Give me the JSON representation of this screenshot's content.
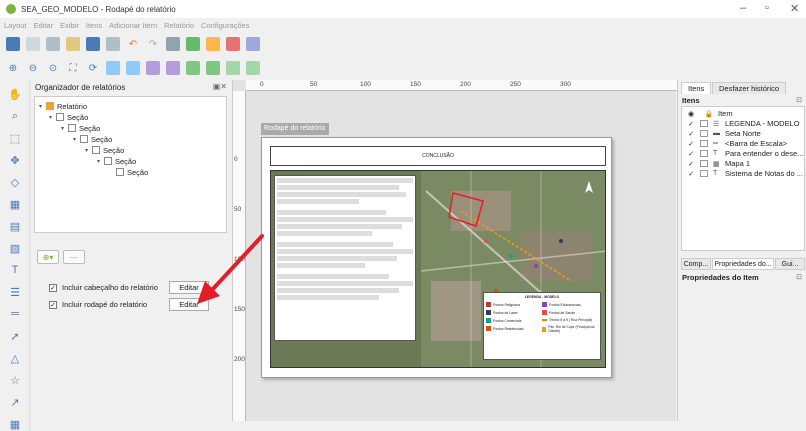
{
  "window": {
    "title": "SEA_GEO_MODELO - Rodapé do relatório"
  },
  "menu": [
    "Layout",
    "Editar",
    "Exibir",
    "Itens",
    "Adicionar Item",
    "Relatório",
    "Configurações"
  ],
  "organizer": {
    "title": "Organizador de relatórios",
    "tree": [
      {
        "label": "Relatório"
      },
      {
        "label": "Seção"
      },
      {
        "label": "Seção"
      },
      {
        "label": "Seção"
      },
      {
        "label": "Seção"
      },
      {
        "label": "Seção"
      },
      {
        "label": "Seção"
      }
    ],
    "include_header": "Incluir cabeçalho do relatório",
    "include_footer": "Incluir rodapé do relatório",
    "edit_label": "Editar"
  },
  "canvas": {
    "ruler_top": [
      "0",
      "50",
      "100",
      "150",
      "200",
      "250",
      "300"
    ],
    "ruler_left": [
      "0",
      "50",
      "100",
      "150",
      "200"
    ],
    "footer_tab": "Rodapé do relatório",
    "conclusion": "CONCLUSÃO",
    "legend_title": "LEGENDA - MODELO",
    "legend_items": [
      {
        "label": "Pontos Religiosos",
        "color": "#c0392b"
      },
      {
        "label": "Pontos Educacionais",
        "color": "#8e44ad"
      },
      {
        "label": "Pontos de Lazer",
        "color": "#2c3e50"
      },
      {
        "label": "Pontos de Saúde",
        "color": "#e74c3c"
      },
      {
        "label": "Pontos Comerciais",
        "color": "#16a085"
      },
      {
        "label": "Trecho 6 a 9 ( Rua Principal)",
        "color": "#e67e22"
      },
      {
        "label": "Pontos Residenciais",
        "color": "#d35400"
      },
      {
        "label": "Pav. Rio de Cupe (Principal da Cidade)",
        "color": "#f39c12"
      }
    ]
  },
  "right_panel": {
    "tabs": [
      "Itens",
      "Desfazer histórico"
    ],
    "items_header": "Itens",
    "col_item": "Item",
    "items": [
      {
        "label": "LEGENDA - MODELO",
        "checked": true
      },
      {
        "label": "Seta Norte",
        "checked": true
      },
      {
        "label": "<Barra de Escala>",
        "checked": true
      },
      {
        "label": "Para entender o dese...",
        "checked": true
      },
      {
        "label": "Mapa 1",
        "checked": true
      },
      {
        "label": "Sistema de Notas do ...",
        "checked": true
      }
    ],
    "bottom_tabs": [
      "Comp...",
      "Propriedades do...",
      "Gui..."
    ],
    "props_title": "Propriedades do Item"
  },
  "colors": {
    "accent": "#e41e26",
    "qgis_green": "#7cb342"
  }
}
